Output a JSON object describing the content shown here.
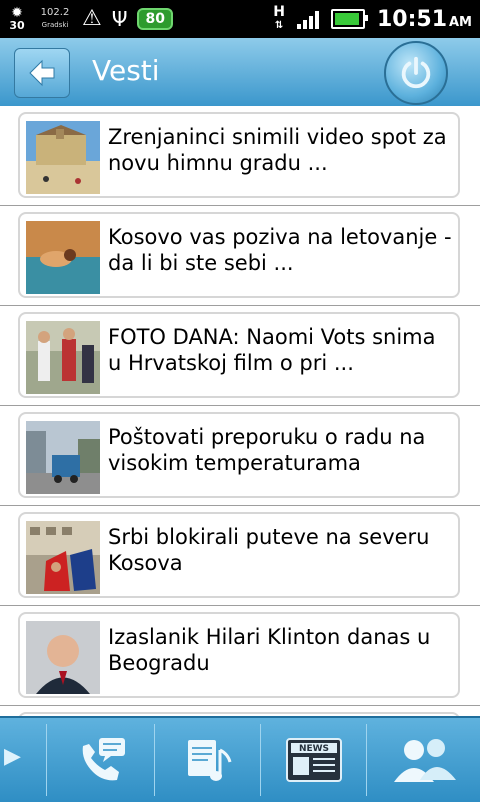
{
  "status_bar": {
    "temperature": "30",
    "radio": "102.2",
    "radio_sub": "Gradski",
    "battery_badge": "80",
    "network_letter": "H",
    "time": "10:51",
    "ampm": "AM"
  },
  "header": {
    "title": "Vesti"
  },
  "news_items": [
    {
      "headline": "Zrenjaninci snimili video spot za novu himnu gradu ..."
    },
    {
      "headline": "Kosovo vas poziva na letovanje - da li bi ste sebi ..."
    },
    {
      "headline": "FOTO DANA: Naomi Vots snima u Hrvatskoj film o pri ..."
    },
    {
      "headline": "Poštovati preporuku o radu na visokim temperaturama"
    },
    {
      "headline": "Srbi blokirali puteve na severu Kosova"
    },
    {
      "headline": "Izaslanik Hilari Klinton danas u Beogradu"
    }
  ],
  "bottom_nav": {
    "news_label": "NEWS"
  }
}
